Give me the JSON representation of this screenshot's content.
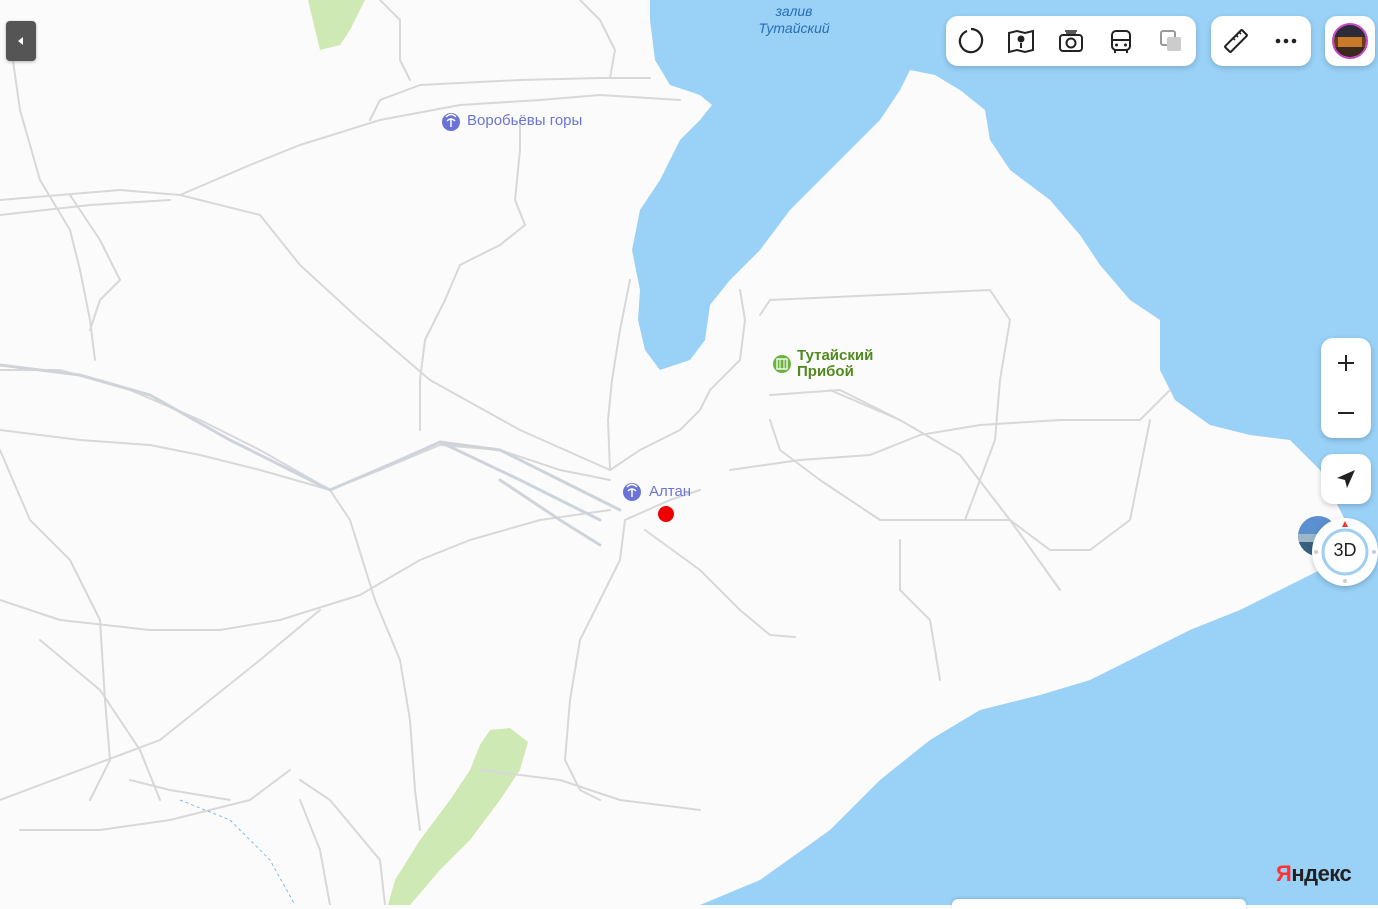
{
  "map": {
    "colors": {
      "land": "#fcfbfc",
      "water": "#99d1f7",
      "park": "#cfe9b5",
      "road": "#d5d5d5",
      "road_major": "#cfd3d8",
      "marker": "#ee0000"
    },
    "labels": {
      "bay_line1": "залив",
      "bay_line2": "Тутайский",
      "poi_vorobyovy": "Воробьёвы горы",
      "poi_altan": "Алтан",
      "park_line1": "Тутайский",
      "park_line2": "Прибой"
    },
    "icons": {
      "poi_vorobyovy": "palm-tree-icon",
      "poi_altan": "palm-tree-icon",
      "park": "park-icon"
    }
  },
  "toolbar": {
    "tools": [
      "layers-icon",
      "map-book-icon",
      "camera-icon",
      "bus-icon",
      "traffic-layer-icon"
    ],
    "extra": [
      "ruler-icon",
      "more-icon"
    ]
  },
  "controls": {
    "zoom_in": "+",
    "zoom_out": "−",
    "view_3d": "3D"
  },
  "brand": {
    "first_letter": "Я",
    "rest": "ндекс"
  }
}
